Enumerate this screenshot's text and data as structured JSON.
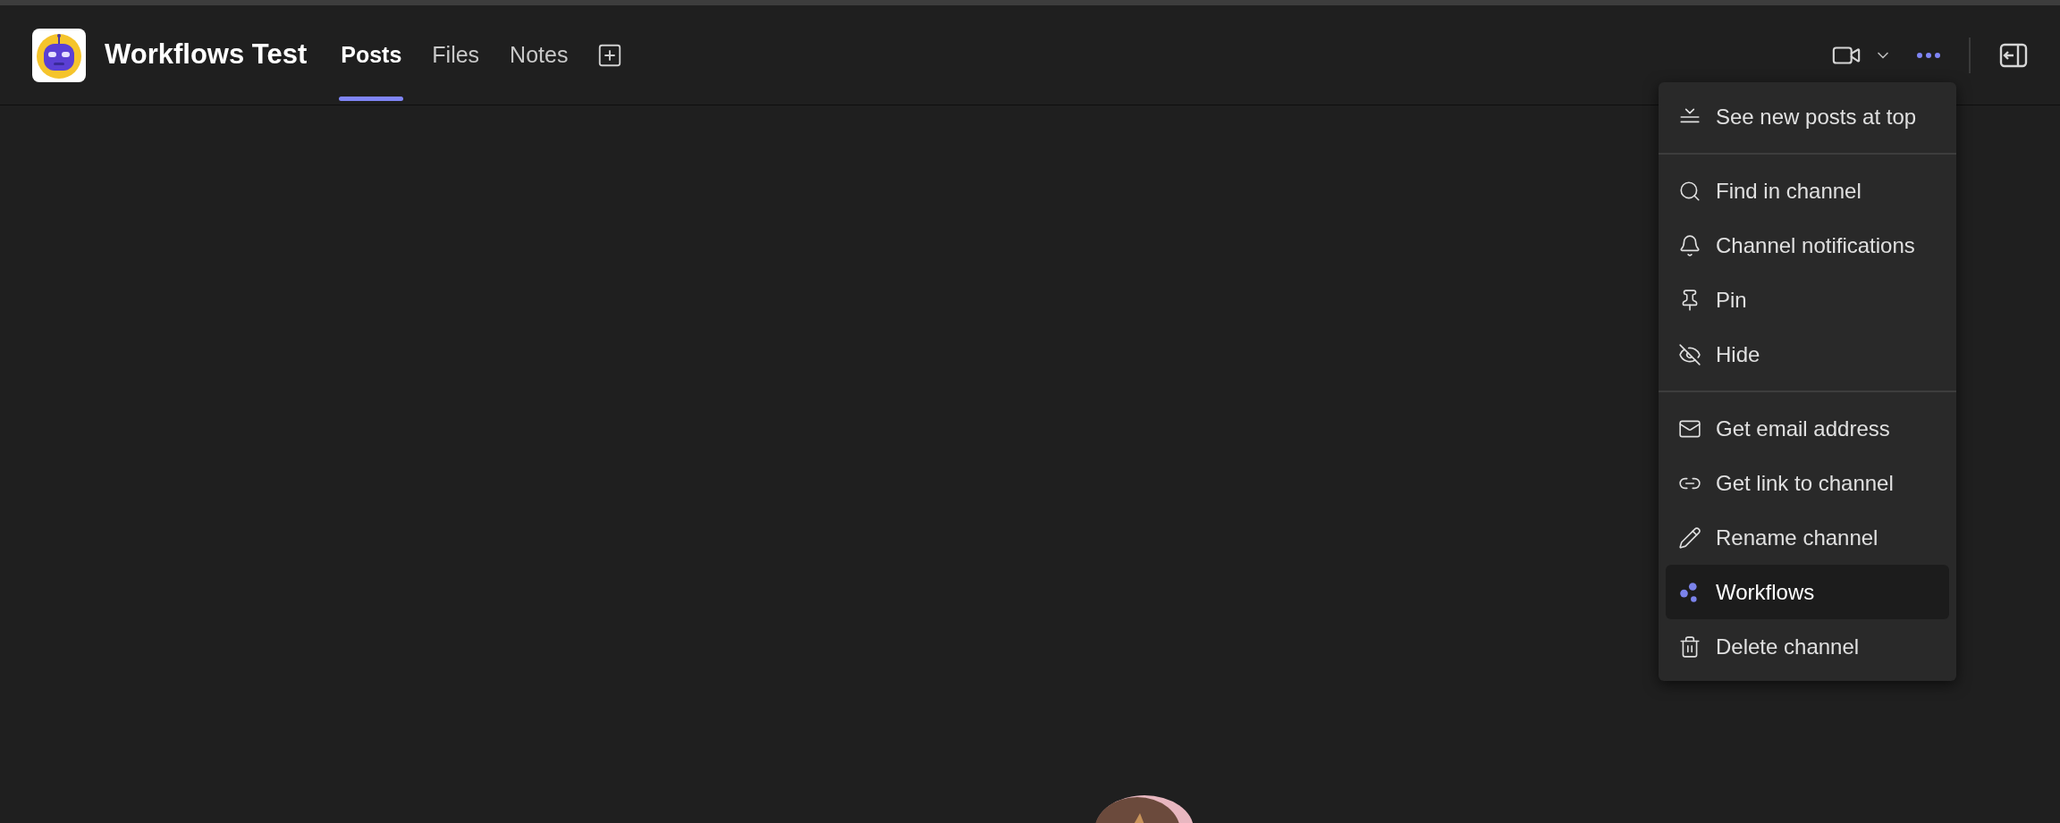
{
  "header": {
    "title": "Workflows Test",
    "tabs": [
      {
        "label": "Posts",
        "selected": true
      },
      {
        "label": "Files",
        "selected": false
      },
      {
        "label": "Notes",
        "selected": false
      }
    ]
  },
  "menu": {
    "items": [
      {
        "kind": "item",
        "label": "See new posts at top",
        "selected": false
      },
      {
        "kind": "separator"
      },
      {
        "kind": "item",
        "label": "Find in channel",
        "selected": false
      },
      {
        "kind": "item",
        "label": "Channel notifications",
        "selected": false
      },
      {
        "kind": "item",
        "label": "Pin",
        "selected": false
      },
      {
        "kind": "item",
        "label": "Hide",
        "selected": false
      },
      {
        "kind": "separator"
      },
      {
        "kind": "item",
        "label": "Get email address",
        "selected": false
      },
      {
        "kind": "item",
        "label": "Get link to channel",
        "selected": false
      },
      {
        "kind": "item",
        "label": "Rename channel",
        "selected": false
      },
      {
        "kind": "item",
        "label": "Workflows",
        "selected": true
      },
      {
        "kind": "item",
        "label": "Delete channel",
        "selected": false
      }
    ]
  }
}
